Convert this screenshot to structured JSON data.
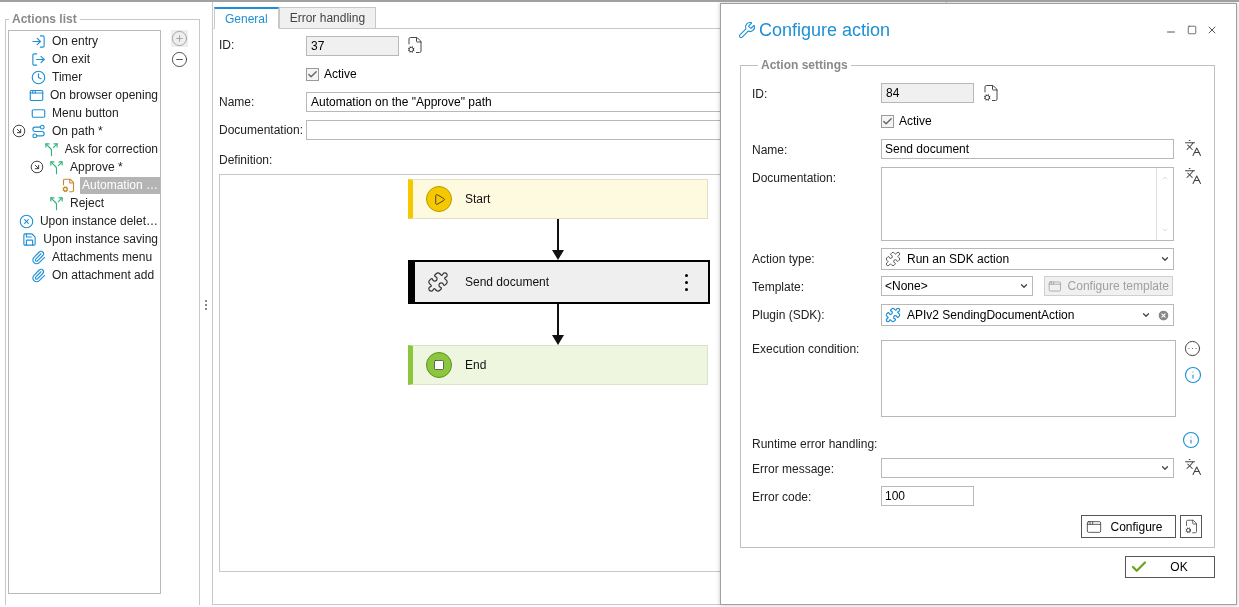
{
  "actions_list": {
    "title": "Actions list",
    "items": [
      {
        "label": "On entry",
        "kind": "entry",
        "selected": false
      },
      {
        "label": "On exit",
        "kind": "exit",
        "selected": false
      },
      {
        "label": "Timer",
        "kind": "timer",
        "selected": false
      },
      {
        "label": "On browser opening",
        "kind": "browser",
        "selected": false
      },
      {
        "label": "Menu button",
        "kind": "menu",
        "selected": false
      },
      {
        "label": "On path *",
        "kind": "path",
        "selected": false,
        "expanded": true,
        "children": [
          {
            "label": "Ask for correction",
            "kind": "branch",
            "selected": false
          },
          {
            "label": "Approve *",
            "kind": "branch",
            "selected": false,
            "expanded": true,
            "children": [
              {
                "label": "Automation …",
                "kind": "automation",
                "selected": true
              }
            ]
          },
          {
            "label": "Reject",
            "kind": "branch",
            "selected": false
          }
        ]
      },
      {
        "label": "Upon instance delet…",
        "kind": "delete",
        "selected": false
      },
      {
        "label": "Upon instance saving",
        "kind": "save",
        "selected": false
      },
      {
        "label": "Attachments menu",
        "kind": "attachment",
        "selected": false
      },
      {
        "label": "On attachment add",
        "kind": "attachment",
        "selected": false
      }
    ]
  },
  "editor": {
    "tabs": [
      {
        "label": "General",
        "selected": true
      },
      {
        "label": "Error handling",
        "selected": false
      }
    ],
    "id": {
      "label": "ID:",
      "value": "37"
    },
    "active": {
      "label": "Active",
      "checked": true
    },
    "name": {
      "label": "Name:",
      "value": "Automation on the \"Approve\" path"
    },
    "documentation": {
      "label": "Documentation:"
    },
    "definition": {
      "label": "Definition:",
      "nodes": [
        {
          "kind": "start",
          "label": "Start",
          "selected": false
        },
        {
          "kind": "action",
          "label": "Send document",
          "selected": true
        },
        {
          "kind": "end",
          "label": "End",
          "selected": false
        }
      ]
    }
  },
  "dialog": {
    "title": "Configure action",
    "section": "Action settings",
    "id": {
      "label": "ID:",
      "value": "84"
    },
    "active": {
      "label": "Active",
      "checked": true
    },
    "name": {
      "label": "Name:",
      "value": "Send document"
    },
    "documentation": {
      "label": "Documentation:"
    },
    "action_type": {
      "label": "Action type:",
      "value": "Run an SDK action"
    },
    "template": {
      "label": "Template:",
      "value": "<None>",
      "button": {
        "label": "Configure template",
        "disabled": true
      }
    },
    "plugin": {
      "label": "Plugin (SDK):",
      "value": "APIv2 SendingDocumentAction"
    },
    "execution_condition": {
      "label": "Execution condition:"
    },
    "runtime_error_handling": {
      "label": "Runtime error handling:"
    },
    "error_message": {
      "label": "Error message:"
    },
    "error_code": {
      "label": "Error code:",
      "value": "100"
    },
    "configure_button": "Configure",
    "ok_button": "OK"
  }
}
